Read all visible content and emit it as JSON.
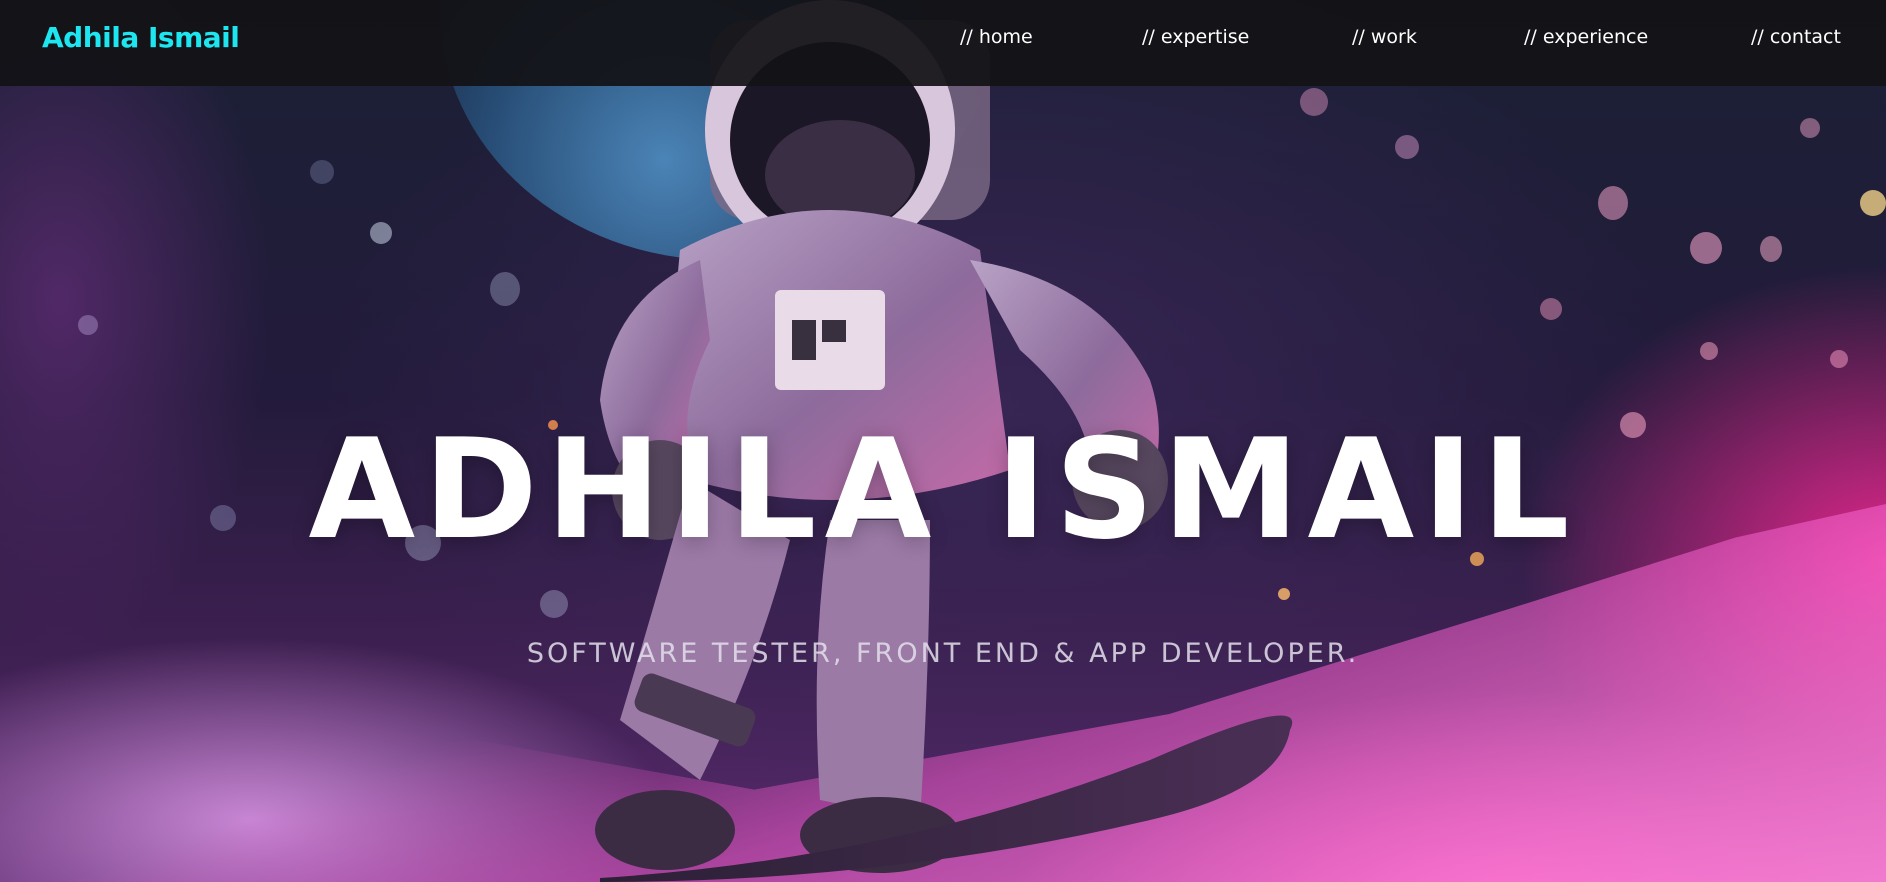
{
  "header": {
    "brand": "Adhila Ismail"
  },
  "nav": {
    "items": [
      {
        "label": "// home"
      },
      {
        "label": "// expertise"
      },
      {
        "label": "// work"
      },
      {
        "label": "// experience"
      },
      {
        "label": "// contact"
      }
    ]
  },
  "hero": {
    "title": "ADHILA ISMAIL",
    "subtitle": "SOFTWARE TESTER, FRONT END & APP DEVELOPER.",
    "background_image": "astronaut-snowboarding-icon"
  },
  "colors": {
    "brand_accent": "#1ee6f0",
    "header_background": "#121216",
    "nav_text": "#ffffff",
    "hero_text": "#ffffff",
    "hero_glow": "#ff3fa6"
  }
}
